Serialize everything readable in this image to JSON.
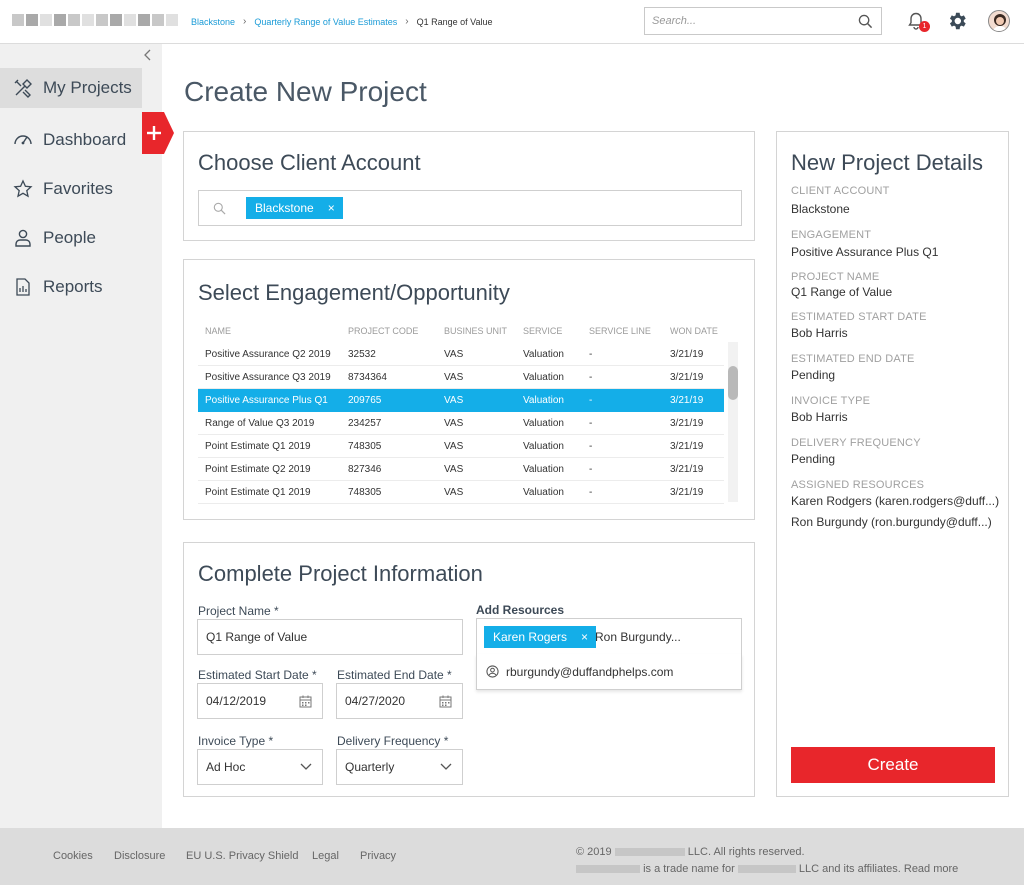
{
  "header": {
    "breadcrumb": [
      "Blackstone",
      "Quarterly Range of Value Estimates",
      "Q1 Range of Value"
    ],
    "search_placeholder": "Search...",
    "notification_count": "1"
  },
  "sidebar": {
    "items": [
      {
        "label": "My Projects",
        "icon": "tools-icon"
      },
      {
        "label": "Dashboard",
        "icon": "gauge-icon"
      },
      {
        "label": "Favorites",
        "icon": "star-icon"
      },
      {
        "label": "People",
        "icon": "person-icon"
      },
      {
        "label": "Reports",
        "icon": "report-icon"
      }
    ],
    "add_label": "+"
  },
  "page_title": "Create New Project",
  "client_account": {
    "title": "Choose Client Account",
    "chip": "Blackstone",
    "chip_remove": "×"
  },
  "engagement": {
    "title": "Select Engagement/Opportunity",
    "columns": [
      "NAME",
      "PROJECT CODE",
      "BUSINES UNIT",
      "SERVICE",
      "SERVICE LINE",
      "WON DATE"
    ],
    "rows": [
      [
        "Positive Assurance Q2 2019",
        "32532",
        "VAS",
        "Valuation",
        "-",
        "3/21/19"
      ],
      [
        "Positive Assurance Q3 2019",
        "8734364",
        "VAS",
        "Valuation",
        "-",
        "3/21/19"
      ],
      [
        "Positive Assurance Plus Q1",
        "209765",
        "VAS",
        "Valuation",
        "-",
        "3/21/19"
      ],
      [
        "Range of Value Q3 2019",
        "234257",
        "VAS",
        "Valuation",
        "-",
        "3/21/19"
      ],
      [
        "Point Estimate Q1 2019",
        "748305",
        "VAS",
        "Valuation",
        "-",
        "3/21/19"
      ],
      [
        "Point Estimate Q2 2019",
        "827346",
        "VAS",
        "Valuation",
        "-",
        "3/21/19"
      ],
      [
        "Point Estimate Q1 2019",
        "748305",
        "VAS",
        "Valuation",
        "-",
        "3/21/19"
      ]
    ],
    "selected_row": 2
  },
  "project_info": {
    "title": "Complete Project Information",
    "project_name_label": "Project Name *",
    "project_name_value": "Q1 Range of Value",
    "start_label": "Estimated Start Date *",
    "start_value": "04/12/2019",
    "end_label": "Estimated End Date *",
    "end_value": "04/27/2020",
    "invoice_label": "Invoice Type *",
    "invoice_value": "Ad Hoc",
    "delivery_label": "Delivery Frequency *",
    "delivery_value": "Quarterly",
    "resources_label": "Add Resources",
    "resource_chip": "Karen Rogers",
    "resource_chip_remove": "×",
    "resource_typed": "Ron Burgundy...",
    "suggestion": "rburgundy@duffandphelps.com"
  },
  "details": {
    "title": "New Project Details",
    "items": [
      {
        "label": "CLIENT ACCOUNT",
        "value": "Blackstone"
      },
      {
        "label": "ENGAGEMENT",
        "value": "Positive Assurance Plus Q1"
      },
      {
        "label": "PROJECT NAME",
        "value": "Q1 Range of Value"
      },
      {
        "label": "ESTIMATED START DATE",
        "value": "Bob Harris"
      },
      {
        "label": "ESTIMATED END DATE",
        "value": "Pending"
      },
      {
        "label": "INVOICE TYPE",
        "value": "Bob Harris"
      },
      {
        "label": "DELIVERY FREQUENCY",
        "value": "Pending"
      },
      {
        "label": "ASSIGNED RESOURCES",
        "value": "Karen Rodgers (karen.rodgers@duff...)"
      }
    ],
    "extra_resource": "Ron Burgundy (ron.burgundy@duff...)",
    "create_label": "Create"
  },
  "footer": {
    "links": [
      "Cookies",
      "Disclosure",
      "EU U.S. Privacy Shield",
      "Legal",
      "Privacy"
    ],
    "copyright_prefix": "© 2019",
    "copyright_suffix": "LLC. All rights reserved.",
    "trade_mid": "is a trade name for",
    "trade_suffix": "LLC and its affiliates. Read more"
  },
  "colors": {
    "accent_blue": "#14aee8",
    "accent_red": "#e8262b",
    "link_blue": "#1a9bd7"
  }
}
